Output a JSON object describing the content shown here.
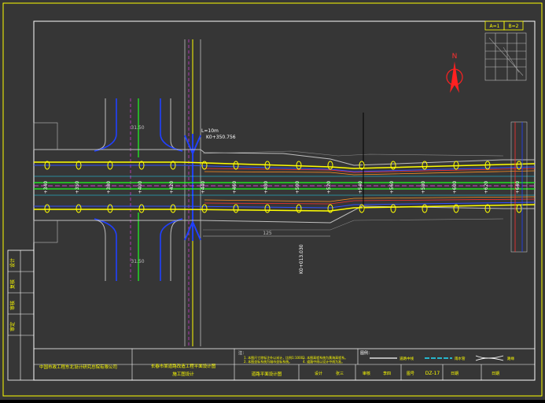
{
  "drawing": {
    "stations": [
      "+220",
      "+230",
      "+340",
      "+350",
      "+360",
      "+370",
      "+380",
      "+390",
      "+400",
      "+410",
      "+420",
      "+430",
      "+440",
      "+450",
      "+460",
      "+470",
      "+480",
      "+490",
      "+500",
      "+510",
      "+520",
      "+530",
      "+540",
      "+550",
      "+560",
      "+570",
      "+580",
      "+590",
      "+600",
      "+610",
      "+620",
      "+630"
    ],
    "station_labels_visible": [
      "+340",
      "+350",
      "+380",
      "+400",
      "+420",
      "+440",
      "+460",
      "+480",
      "+500",
      "+520",
      "+540",
      "+560",
      "+580",
      "+600",
      "+620",
      "+640"
    ],
    "label_k": "K0+350.756",
    "label_k2": "L=10m",
    "label_end_k": "K0+013.030",
    "dim_top_left": "31.50",
    "dim_bottom_left": "31.50",
    "dim_125": "125",
    "north": "N",
    "key_top": [
      "A=1",
      "B=2"
    ]
  },
  "title_block": {
    "left_labels": [
      "设计",
      "复核",
      "审核",
      "审定"
    ],
    "company": "中国市政工程东北设计研究总院有限公司",
    "project": "长春市某道路改造工程平面设计图",
    "project_sub": "施工图设计",
    "drawing_name": "道路平面设计图",
    "notes_title": "注：",
    "notes": [
      "1. 本图尺寸除标注外以米计，比例1:1000。",
      "2. 本图坐标系统为城市坐标系统。",
      "3. 本图高程系统为黄海高程系。",
      "4. 道路中线以设计中线为准。"
    ],
    "legend_title": "图例：",
    "legend": [
      {
        "name": "道路中线"
      },
      {
        "name": "雨水管"
      },
      {
        "name": "路缘"
      }
    ],
    "cells": {
      "design": "设计",
      "design_name": "张三",
      "check": "审核",
      "check_name": "李四",
      "drawing_no_label": "图号",
      "drawing_no": "DZ-17",
      "date_label": "日期",
      "date": "日期"
    }
  }
}
